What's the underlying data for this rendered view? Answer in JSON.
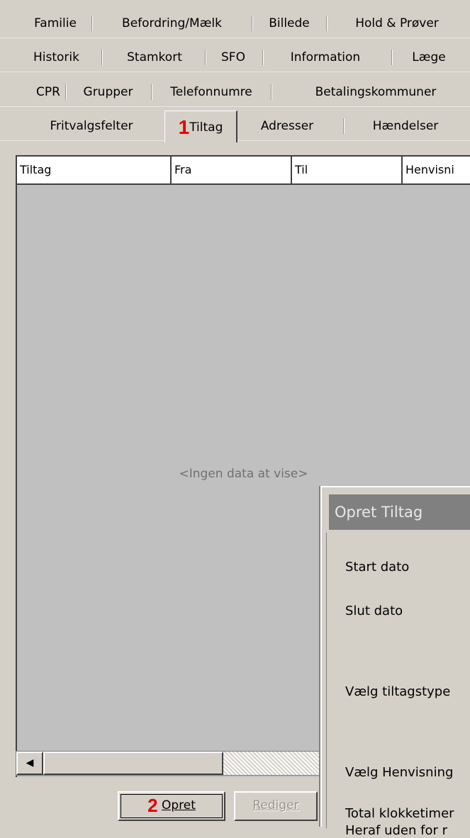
{
  "tabs": {
    "row1": [
      "Familie",
      "Befordring/Mælk",
      "Billede",
      "Hold & Prøver"
    ],
    "row2": [
      "Historik",
      "Stamkort",
      "SFO",
      "Information",
      "Læge"
    ],
    "row3": [
      "CPR",
      "Grupper",
      "Telefonnumre",
      "Betalingskommuner"
    ],
    "row4": [
      "Fritvalgsfelter",
      "Tiltag",
      "Adresser",
      "Hændelser"
    ],
    "active": "Tiltag",
    "annotation": "1"
  },
  "grid": {
    "columns": [
      "Tiltag",
      "Fra",
      "Til",
      "Henvisni"
    ],
    "empty_message": "<Ingen data at vise>"
  },
  "buttons": {
    "annotation": "2",
    "create": "Opret",
    "edit": "Rediger"
  },
  "dialog": {
    "title": "Opret Tiltag",
    "labels": {
      "start_date": "Start dato",
      "end_date": "Slut dato",
      "type": "Vælg tiltagstype",
      "referral": "Vælg Henvisning",
      "total_hours": "Total klokketimer",
      "outside": "Heraf uden for r"
    }
  }
}
